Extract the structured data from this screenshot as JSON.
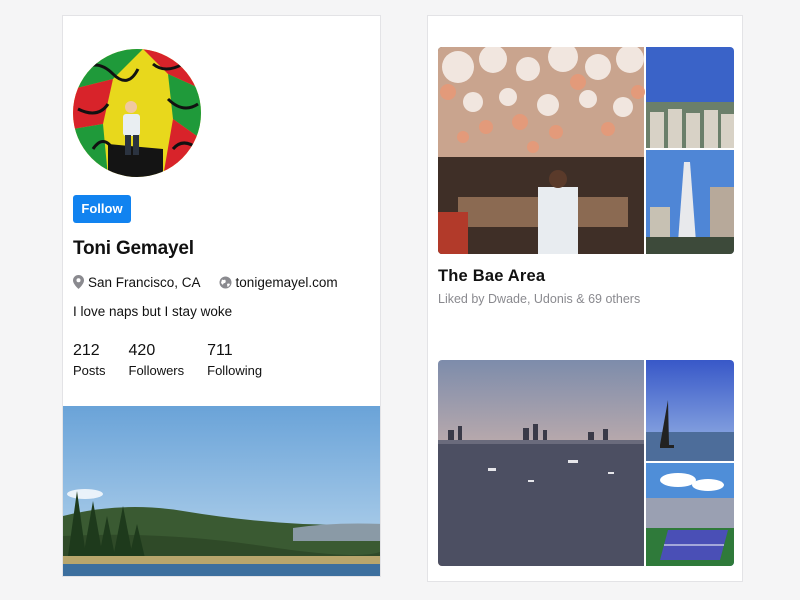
{
  "profile": {
    "follow_label": "Follow",
    "name": "Toni Gemayel",
    "location": "San Francisco, CA",
    "website": "tonigemayel.com",
    "bio": "I love naps but I stay woke",
    "stats": [
      {
        "value": "212",
        "label": "Posts"
      },
      {
        "value": "420",
        "label": "Followers"
      },
      {
        "value": "711",
        "label": "Following"
      }
    ],
    "location_icon": "map-pin-icon",
    "website_icon": "globe-icon"
  },
  "album": {
    "title": "The Bae Area",
    "liked_by": "Liked by Dwade, Udonis & 69 others"
  },
  "colors": {
    "accent": "#1183f0",
    "muted_text": "#8a8a8f",
    "background": "#f5f5f6"
  }
}
